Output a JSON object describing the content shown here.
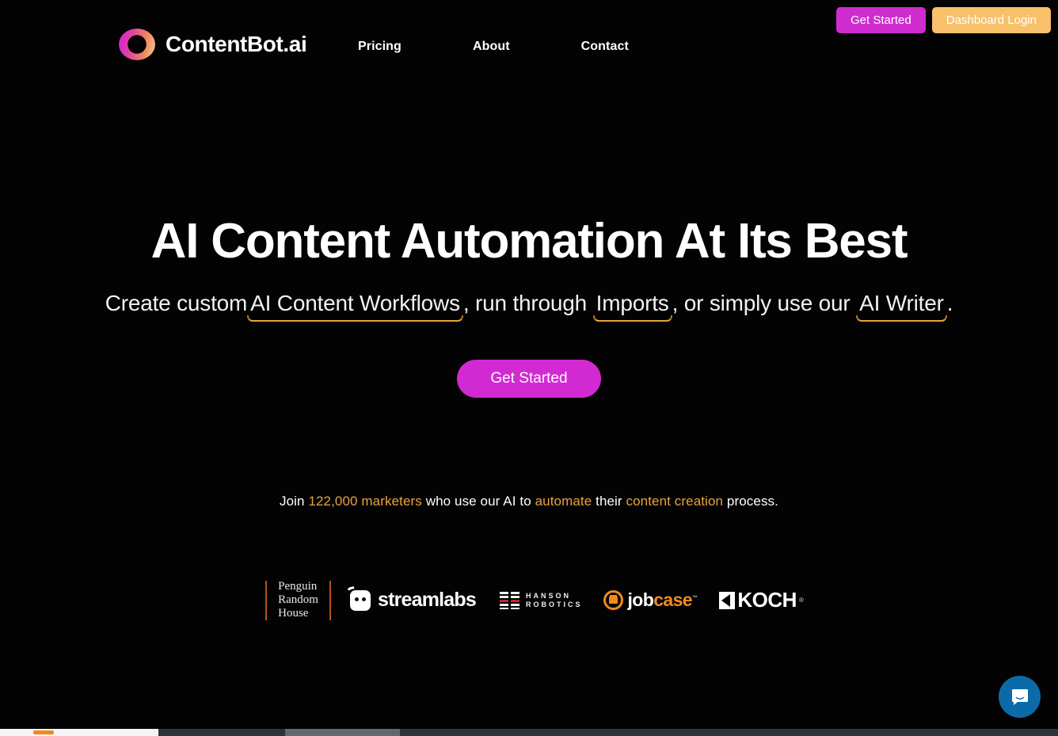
{
  "header": {
    "brand": {
      "name": "ContentBot.ai",
      "logo_icon": "gradient-ring-icon"
    },
    "nav": [
      {
        "label": "Pricing"
      },
      {
        "label": "About"
      },
      {
        "label": "Contact"
      }
    ],
    "actions": {
      "get_started": "Get Started",
      "dashboard_login": "Dashboard Login"
    }
  },
  "hero": {
    "title": "AI Content Automation At Its Best",
    "subheading": {
      "part1": "Create custom",
      "link1": "AI Content Workflows",
      "part2": ", run through ",
      "link2": "Imports",
      "part3": ", or simply use our ",
      "link3": "AI Writer",
      "part4": "."
    },
    "cta": "Get Started",
    "social_proof": {
      "prefix": "Join ",
      "count": "122,000 marketers",
      "mid1": " who use our AI to ",
      "highlight1": "automate",
      "mid2": " their ",
      "highlight2": "content creation",
      "suffix": " process."
    }
  },
  "logos": [
    {
      "name": "Penguin Random House",
      "line1": "Penguin",
      "line2": "Random",
      "line3": "House"
    },
    {
      "name": "streamlabs",
      "text": "streamlabs"
    },
    {
      "name": "Hanson Robotics",
      "line1": "HANSON",
      "line2": "ROBOTICS"
    },
    {
      "name": "jobcase",
      "part1": "job",
      "part2": "case",
      "tm": "™"
    },
    {
      "name": "Koch",
      "text": "KOCH",
      "tm": "®"
    }
  ],
  "chat": {
    "icon": "chat-bubble-icon"
  },
  "colors": {
    "background": "#030303",
    "magenta": "#d22ad2",
    "orange_btn": "#f8c06a",
    "orange_accent": "#e9a23c",
    "jobcase_orange": "#f08a1e",
    "chat_blue": "#0d6aa8"
  }
}
